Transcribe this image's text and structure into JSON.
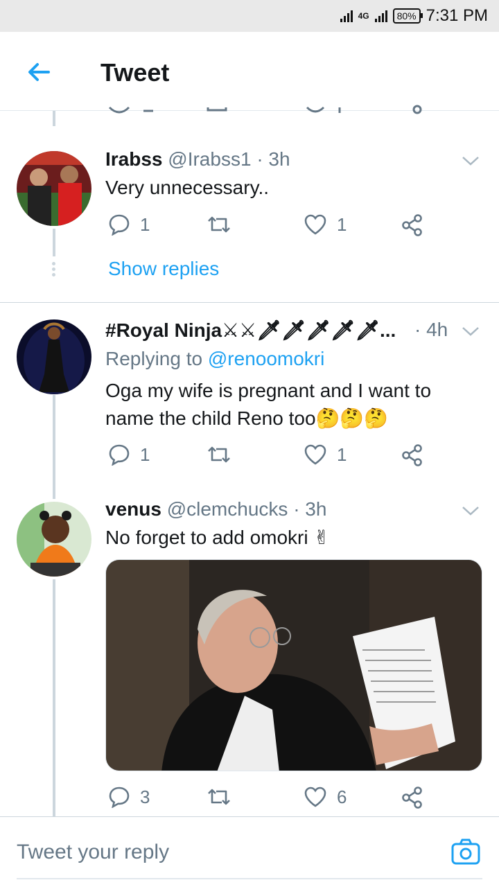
{
  "status_bar": {
    "network": "4G",
    "battery": "80%",
    "time": "7:31 PM"
  },
  "app_bar": {
    "title": "Tweet"
  },
  "colors": {
    "accent": "#1da1f2",
    "secondary_text": "#657786",
    "divider": "#ccd6dd"
  },
  "tweets": [
    {
      "name": "Irabss",
      "handle": "@Irabss1",
      "time": "· 3h",
      "text": "Very unnecessary..",
      "replies": "1",
      "likes": "1",
      "show_replies": "Show replies"
    },
    {
      "name": "#Royal Ninja⚔⚔🗡🗡🗡🗡🗡...",
      "handle": "",
      "time": "· 4h",
      "replying_prefix": "Replying to",
      "replying_to": "@renoomokri",
      "text": "Oga my wife is pregnant and I want to name the child Reno too🤔🤔🤔",
      "replies": "1",
      "likes": "1"
    },
    {
      "name": "venus",
      "handle": "@clemchucks",
      "time": "· 3h",
      "text": "No forget to add omokri ✌",
      "replies": "3",
      "likes": "6"
    }
  ],
  "reply_bar": {
    "placeholder": "Tweet your reply"
  },
  "icons": {
    "back": "arrow-left-icon",
    "reply": "speech-bubble-icon",
    "retweet": "retweet-icon",
    "like": "heart-icon",
    "share": "share-icon",
    "caret": "chevron-down-icon",
    "camera": "camera-icon"
  }
}
